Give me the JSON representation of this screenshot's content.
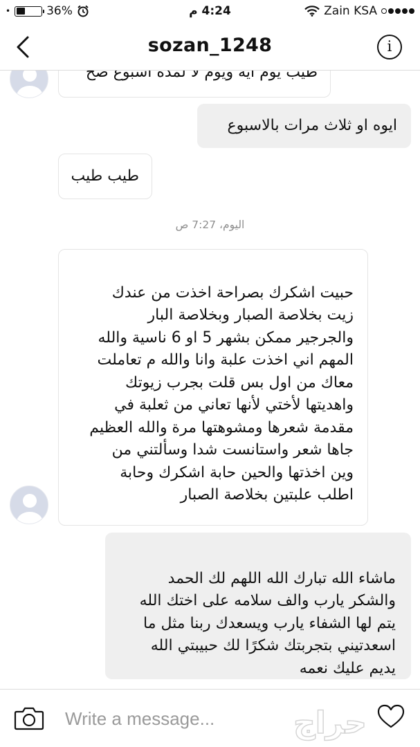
{
  "status_bar": {
    "battery_percent": "36%",
    "battery_level": 0.36,
    "time": "4:24 م",
    "carrier": "Zain KSA",
    "wifi_icon": "wifi-icon",
    "alarm_icon": "alarm-clock-icon"
  },
  "header": {
    "title": "sozan_1248",
    "back_icon": "chevron-left-icon",
    "info_label": "i"
  },
  "chat": {
    "messages": [
      {
        "direction": "incoming",
        "text": "طيب يوم ايه ويوم لا لمده اسبوع صح"
      },
      {
        "direction": "outgoing",
        "text": "ايوه او ثلاث مرات بالاسبوع"
      },
      {
        "direction": "incoming",
        "text": "طيب طيب"
      },
      {
        "direction": "incoming",
        "text": "حبيت اشكرك بصراحة اخذت من عندك\nزيت بخلاصة الصبار وبخلاصة البار\nوالجرجير ممكن بشهر 5 او 6 ناسية والله\nالمهم اني اخذت علبة وانا والله م تعاملت\nمعاك من اول بس قلت بجرب زيوتك\nواهديتها لأختي لأنها تعاني من ثعلبة في\nمقدمة شعرها ومشوهتها مرة والله العظيم\nجاها شعر واستانست شدا وسألتني من\nوين اخذتها والحين حابة اشكرك وحابة\nاطلب علبتين بخلاصة الصبار"
      },
      {
        "direction": "outgoing",
        "text": "ماشاء الله تبارك الله اللهم لك الحمد\nوالشكر يارب والف سلامه على اختك الله\nيتم لها الشفاء يارب ويسعدك ربنا مثل ما\nاسعدتيني بتجربتك شكرًا لك حبيبتي الله\nيديم عليك نعمه"
      }
    ],
    "timestamp": "اليوم، 7:27 ص"
  },
  "composer": {
    "placeholder": "Write a message...",
    "camera_icon": "camera-icon",
    "heart_icon": "heart-icon"
  },
  "watermark": {
    "text": "حراج"
  }
}
